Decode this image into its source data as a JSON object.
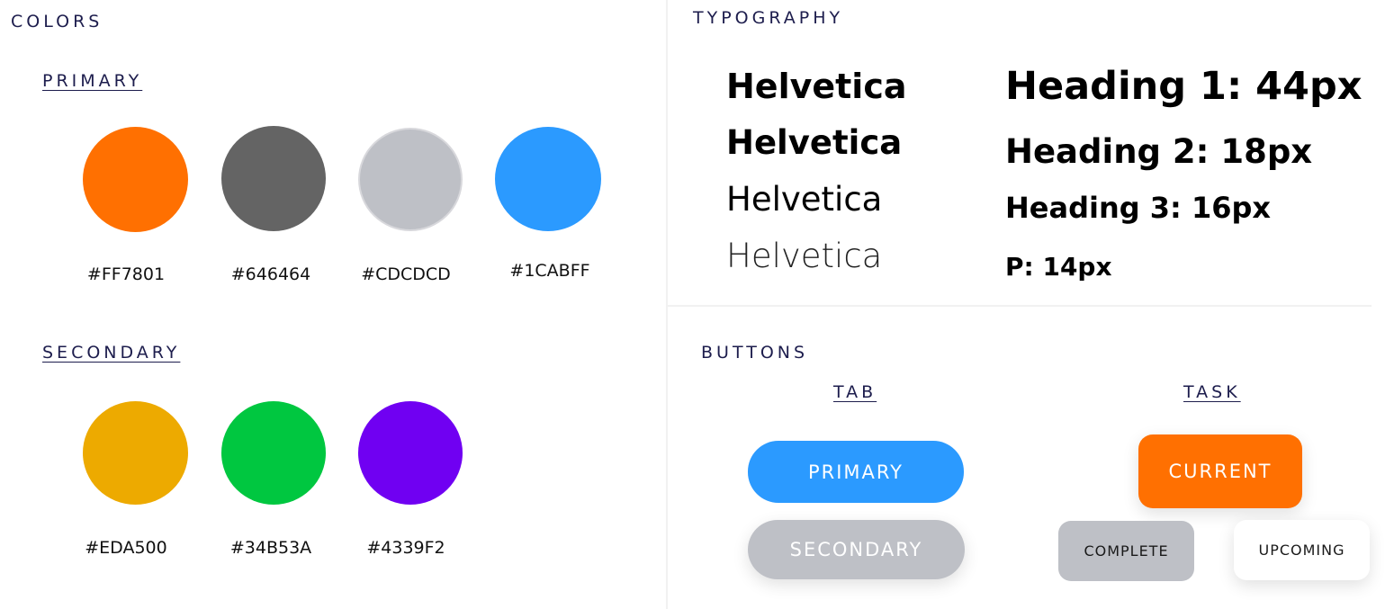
{
  "colors": {
    "title": "COLORS",
    "primary_label": "PRIMARY",
    "secondary_label": "SECONDARY",
    "primary": [
      {
        "hex": "#FF7801",
        "color": "#FF7001"
      },
      {
        "hex": "#646464",
        "color": "#646464"
      },
      {
        "hex": "#CDCDCD",
        "color": "#BEC0C6"
      },
      {
        "hex": "#1CABFF",
        "color": "#2B9AFF"
      }
    ],
    "secondary": [
      {
        "hex": "#EDA500",
        "color": "#EDAA00"
      },
      {
        "hex": "#34B53A",
        "color": "#00C740"
      },
      {
        "hex": "#4339F2",
        "color": "#7000F2"
      }
    ]
  },
  "typography": {
    "title": "TYPOGRAPHY",
    "fonts": [
      "Helvetica",
      "Helvetica",
      "Helvetica",
      "Helvetica"
    ],
    "headings": [
      "Heading 1: 44px",
      "Heading 2: 18px",
      "Heading 3: 16px",
      "P: 14px"
    ]
  },
  "buttons": {
    "title": "BUTTONS",
    "tab_label": "TAB",
    "task_label": "TASK",
    "tab_primary": "PRIMARY",
    "tab_secondary": "SECONDARY",
    "task_current": "CURRENT",
    "task_complete": "COMPLETE",
    "task_upcoming": "UPCOMING",
    "colors": {
      "primary": "#2B9AFF",
      "secondary": "#BEC0C6",
      "current": "#FF7001",
      "complete": "#BEC0C6",
      "upcoming": "#FFFFFF"
    }
  }
}
